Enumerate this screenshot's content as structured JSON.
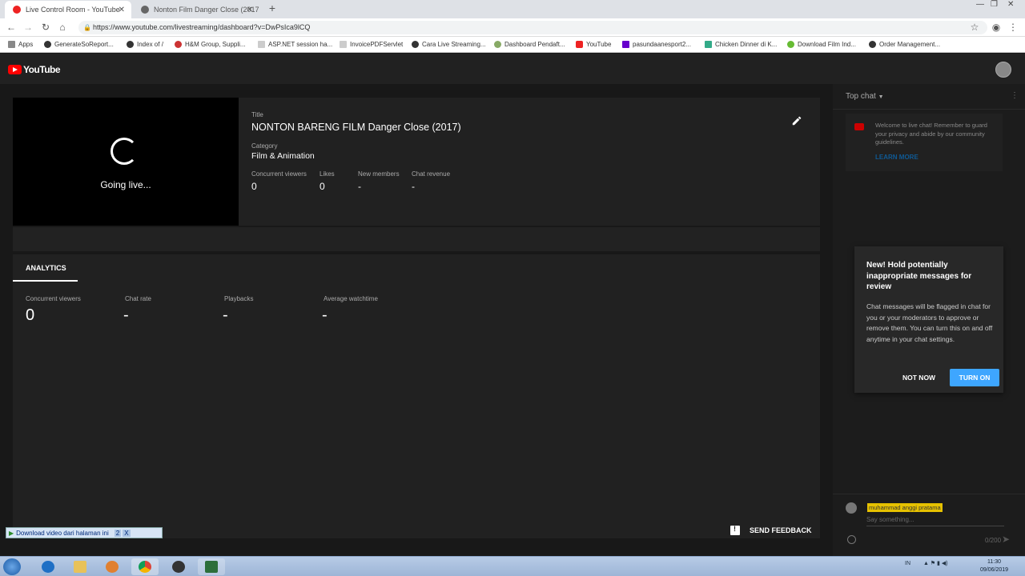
{
  "browser": {
    "tabs": [
      {
        "label": "Live Control Room - YouTube",
        "active": true
      },
      {
        "label": "Nonton Film Danger Close (2017",
        "active": false
      }
    ],
    "url": "https://www.youtube.com/livestreaming/dashboard?v=DwPsIca9lCQ",
    "bookmarks": [
      "Apps",
      "GenerateSoReport...",
      "Index of /",
      "H&M Group, Suppli...",
      "ASP.NET session ha...",
      "InvoicePDFServlet",
      "Cara Live Streaming...",
      "Dashboard Pendaft...",
      "YouTube",
      "pasundaanesport2...",
      "Chicken Dinner di K...",
      "Download Film Ind...",
      "Order Management..."
    ]
  },
  "header": {
    "logo_text": "YouTube"
  },
  "stream": {
    "status": "Going live...",
    "title_label": "Title",
    "title": "NONTON BARENG FILM Danger Close (2017)",
    "category_label": "Category",
    "category": "Film & Animation",
    "stats": [
      {
        "label": "Concurrent viewers",
        "value": "0"
      },
      {
        "label": "Likes",
        "value": "0"
      },
      {
        "label": "New members",
        "value": "-"
      },
      {
        "label": "Chat revenue",
        "value": "-"
      }
    ]
  },
  "analytics": {
    "tab": "ANALYTICS",
    "metrics": [
      {
        "label": "Concurrent viewers",
        "value": "0"
      },
      {
        "label": "Chat rate",
        "value": "-"
      },
      {
        "label": "Playbacks",
        "value": "-"
      },
      {
        "label": "Average watchtime",
        "value": "-"
      }
    ]
  },
  "feedback": {
    "label": "SEND FEEDBACK"
  },
  "chat": {
    "mode": "Top chat",
    "welcome": "Welcome to live chat! Remember to guard your privacy and abide by our community guidelines.",
    "learn_more": "LEARN MORE",
    "popup": {
      "title": "New! Hold potentially inappropriate messages for review",
      "body": "Chat messages will be flagged in chat for you or your moderators to approve or remove them. You can turn this on and off anytime in your chat settings.",
      "not_now": "NOT NOW",
      "turn_on": "TURN ON"
    },
    "user_name": "muhammad anggi pratama",
    "placeholder": "Say something...",
    "char_count": "0/200"
  },
  "download_bar": {
    "label": "Download video dari halaman ini",
    "count": "2",
    "close": "X"
  },
  "taskbar": {
    "lang": "IN",
    "time": "11:30",
    "date": "09/06/2019"
  },
  "colors": {
    "accent": "#3ea6ff",
    "yt_red": "#ff0000",
    "bg": "#181818"
  }
}
